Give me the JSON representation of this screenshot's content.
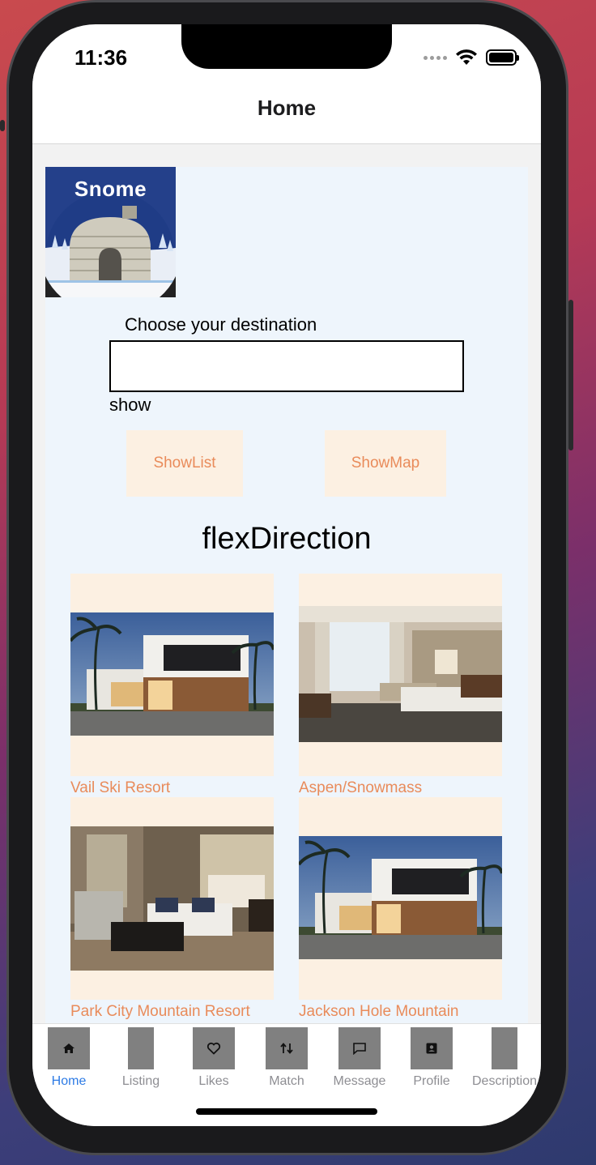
{
  "status": {
    "time": "11:36"
  },
  "header": {
    "title": "Home"
  },
  "logo": {
    "text": "Snome"
  },
  "search": {
    "label": "Choose your destination",
    "value": "",
    "placeholder": ""
  },
  "show_text": "show",
  "buttons": {
    "show_list": "ShowList",
    "show_map": "ShowMap"
  },
  "section_title": "flexDirection",
  "cards": [
    {
      "title": "Vail Ski Resort",
      "image": "modern-house"
    },
    {
      "title": "Aspen/Snowmass",
      "image": "hotel-bedroom"
    },
    {
      "title": "Park City Mountain Resort",
      "image": "living-room-suite"
    },
    {
      "title": "Jackson Hole Mountain",
      "image": "modern-house"
    }
  ],
  "tabs": [
    {
      "label": "Home",
      "icon": "home-icon",
      "active": true
    },
    {
      "label": "Listing",
      "icon": "none",
      "active": false
    },
    {
      "label": "Likes",
      "icon": "heart-icon",
      "active": false
    },
    {
      "label": "Match",
      "icon": "swap-icon",
      "active": false
    },
    {
      "label": "Message",
      "icon": "chat-icon",
      "active": false
    },
    {
      "label": "Profile",
      "icon": "contact-card-icon",
      "active": false
    },
    {
      "label": "Description",
      "icon": "none",
      "active": false
    }
  ],
  "colors": {
    "accent": "#e98b5a",
    "card_bg": "#fcf0e2",
    "active_tab": "#2d7be5",
    "content_bg": "#eef5fc"
  }
}
